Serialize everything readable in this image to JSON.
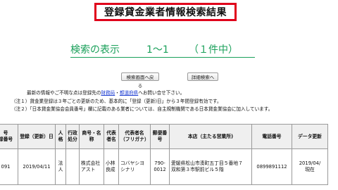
{
  "page": {
    "title": "登録貸金業者情報検索結果"
  },
  "result": {
    "label": "検索の表示",
    "range": "1～1",
    "count": "（１件中）"
  },
  "buttons": {
    "back": "検索画面へ戻る",
    "detail": "詳細検索へ"
  },
  "notes": {
    "line1_pre": "最新の情報やご不明な点は登録先の",
    "line1_link1": "財務局",
    "line1_sep": "・",
    "line1_link2": "都道府県",
    "line1_post": "へお問い合せ下さい。",
    "line2": "（注１）貸金業登録は３年ごとの更新のため、基本的に「登録（更新)日」から３年間登録有効です。",
    "line3": "（注２）「日本貸金業協会会員番号」欄に記載のある業者については、自主規制機関である日本貸金業協会に加入しています。"
  },
  "table": {
    "headers": {
      "regno_a": "号",
      "regno_b": "録番号",
      "regdate": "登録（更新）日",
      "type": "人格",
      "admin": "行政処分",
      "company": "商号・名称",
      "rep": "代表者名",
      "rep_kana": "代表者名（フリガナ）",
      "postal": "郵便番号",
      "address": "本店（主たる営業所)",
      "phone": "電話番号",
      "data": "データ更新"
    },
    "row": {
      "regno": "091",
      "regdate": "2019/04/11",
      "type": "法人",
      "admin": "",
      "company": "株式会社アスト",
      "rep": "小林良成",
      "rep_kana": "コバヤシヨシナリ",
      "postal": "790-0012",
      "address": "愛媛県松山市湊町五丁目５番地７　双和第３市駅前ビル５階",
      "phone": "0899891112",
      "data_date": "2019/04/",
      "data_status": "現在"
    }
  }
}
